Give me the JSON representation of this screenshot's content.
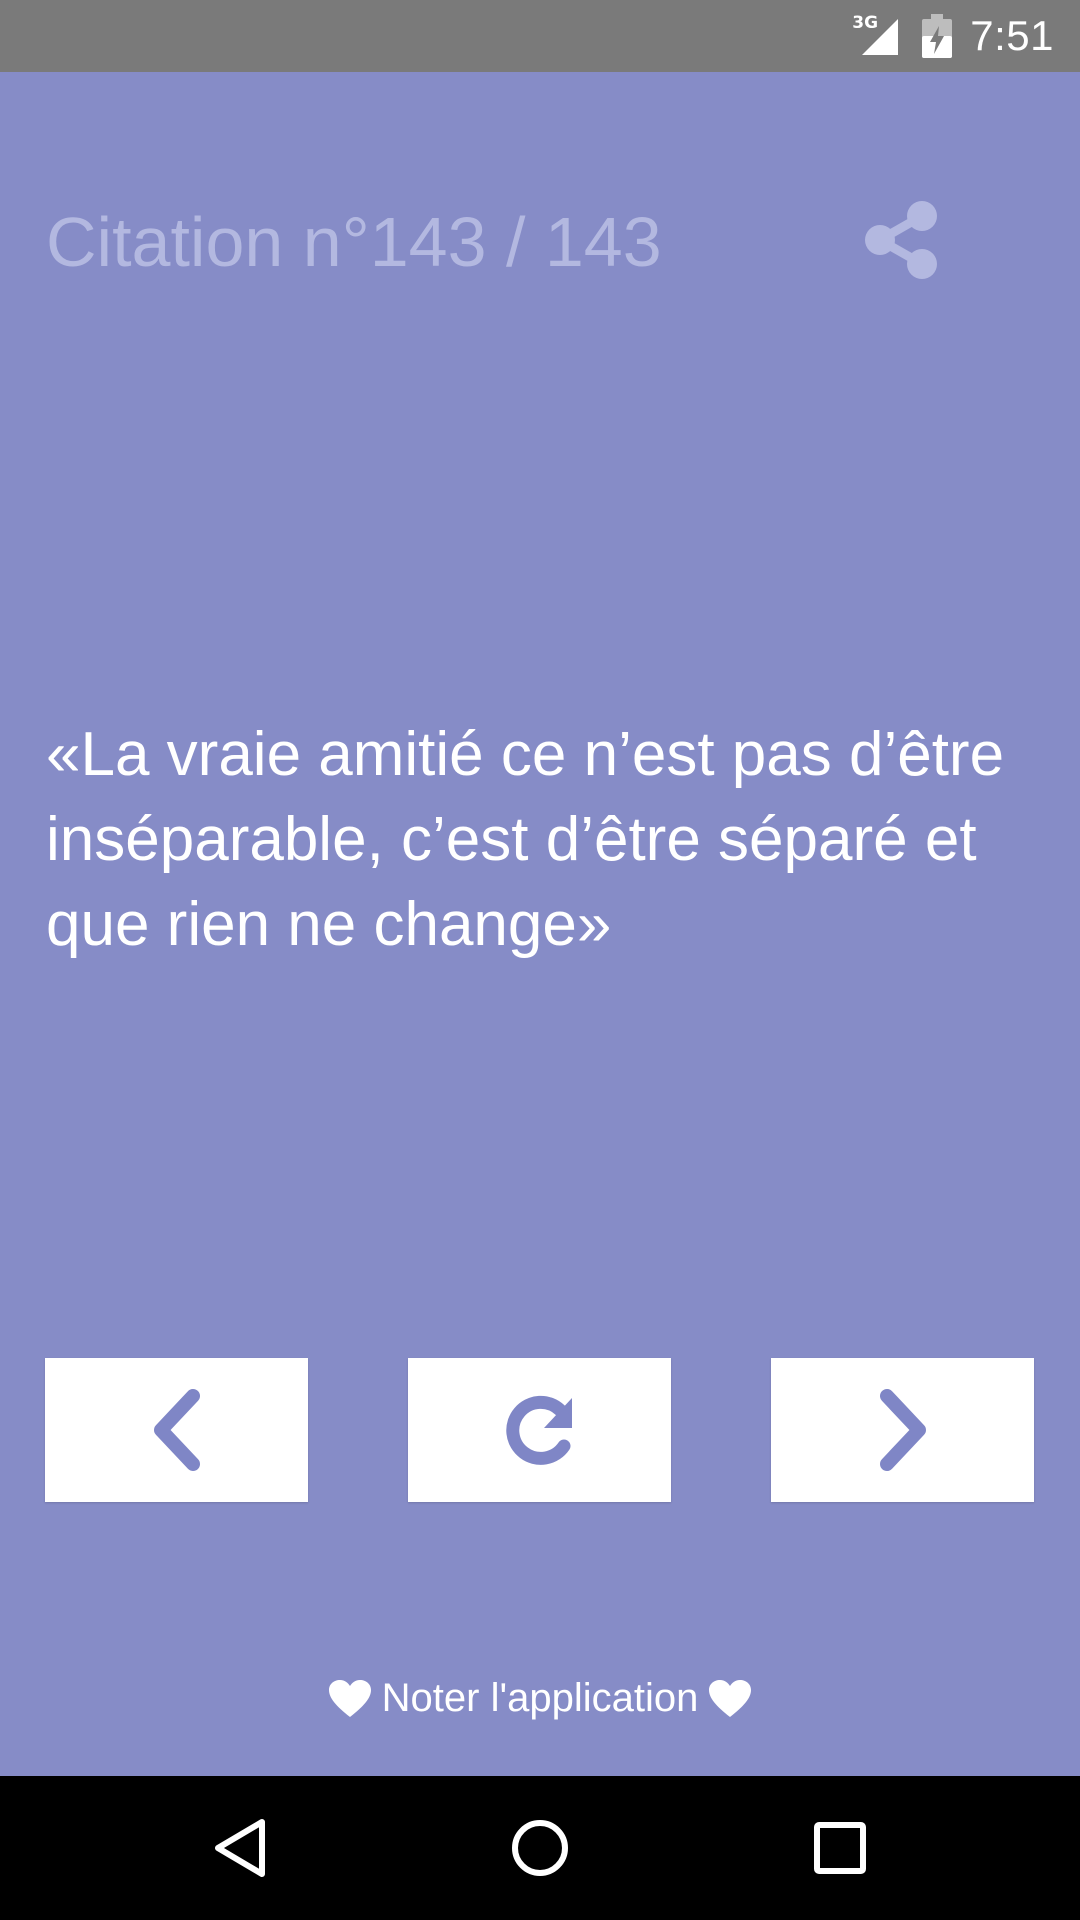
{
  "status_bar": {
    "network": "3G",
    "time": "7:51",
    "icons": [
      "signal-icon",
      "battery-charging-icon"
    ]
  },
  "header": {
    "title": "Citation n°143 / 143",
    "share_icon": "share-icon"
  },
  "quote": {
    "text": "«La vraie amitié ce n’est pas d’être inséparable, c’est d’être séparé et que rien ne change»"
  },
  "navigation": {
    "buttons": [
      {
        "icon": "chevron-left-icon"
      },
      {
        "icon": "refresh-icon"
      },
      {
        "icon": "chevron-right-icon"
      }
    ]
  },
  "footer": {
    "rate_label": "Noter l'application",
    "icon": "heart-icon"
  },
  "system_nav": {
    "icons": [
      "back-icon",
      "home-icon",
      "recents-icon"
    ]
  },
  "colors": {
    "background": "#868cc7",
    "status_bar": "#7a7a7a",
    "title_text": "#b3b8e0",
    "accent_icon": "#7f86c6",
    "button_bg": "#ffffff",
    "nav_bar": "#000000"
  }
}
